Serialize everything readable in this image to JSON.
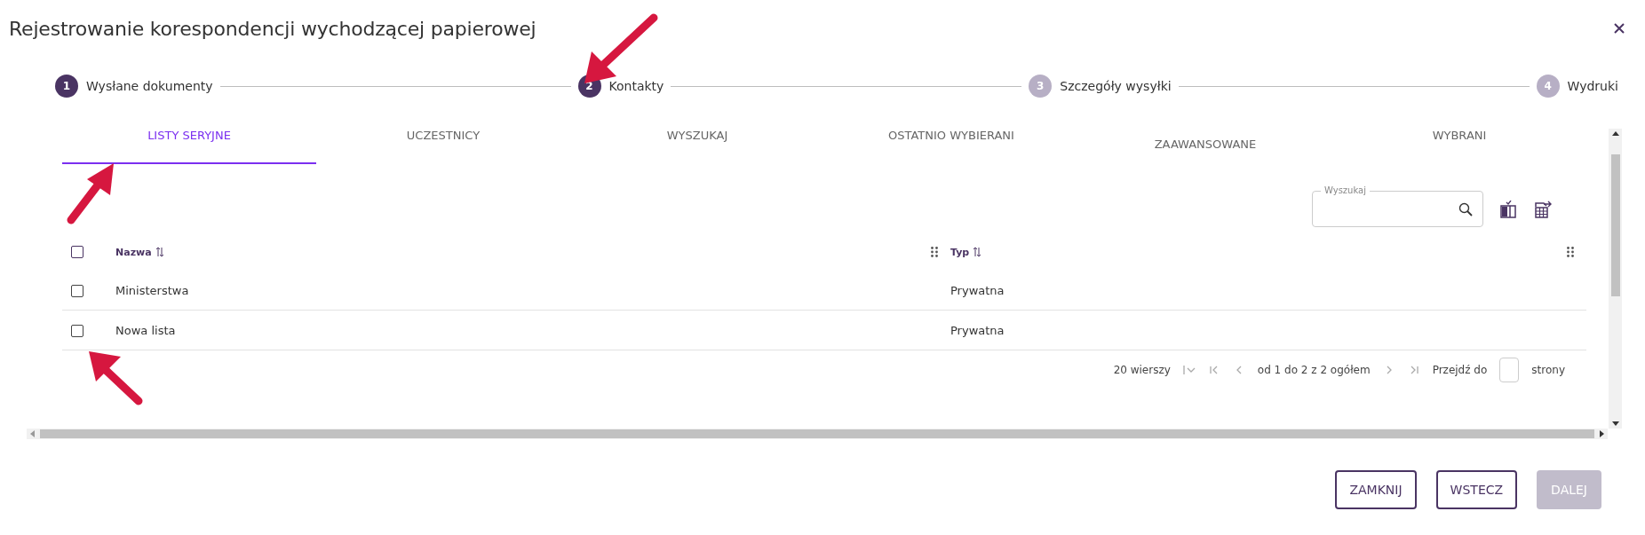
{
  "dialog": {
    "title": "Rejestrowanie korespondencji wychodzącej papierowej"
  },
  "steps": [
    {
      "number": "1",
      "label": "Wysłane dokumenty",
      "reached": true
    },
    {
      "number": "2",
      "label": "Kontakty",
      "reached": true
    },
    {
      "number": "3",
      "label": "Szczegóły wysyłki",
      "reached": false
    },
    {
      "number": "4",
      "label": "Wydruki",
      "reached": false
    }
  ],
  "tabs": [
    {
      "label": "LISTY SERYJNE",
      "selected": true,
      "clipped_top": false
    },
    {
      "label": "UCZESTNICY",
      "selected": false,
      "clipped_top": false
    },
    {
      "label": "WYSZUKAJ",
      "selected": false,
      "clipped_top": false
    },
    {
      "label": "OSTATNIO WYBIERANI",
      "selected": false,
      "clipped_top": false
    },
    {
      "label": "ZAAWANSOWANE",
      "selected": false,
      "clipped_top": true
    },
    {
      "label": "WYBRANI",
      "selected": false,
      "clipped_top": false
    }
  ],
  "search": {
    "label": "Wyszukaj"
  },
  "table": {
    "header_checked": false,
    "columns": [
      {
        "label": "Nazwa"
      },
      {
        "label": "Typ"
      }
    ],
    "rows": [
      {
        "checked": false,
        "cells": [
          "Ministerstwa",
          "Prywatna"
        ]
      },
      {
        "checked": false,
        "cells": [
          "Nowa lista",
          "Prywatna"
        ]
      }
    ]
  },
  "pagination": {
    "rows_per_page": "20 wierszy",
    "range": "od 1 do 2 z 2 ogółem",
    "goto_before": "Przejdź do",
    "goto_after": "strony"
  },
  "buttons": [
    {
      "label": "ZAMKNIJ",
      "disabled": false
    },
    {
      "label": "WSTECZ",
      "disabled": false
    },
    {
      "label": "DALEJ",
      "disabled": true
    }
  ]
}
